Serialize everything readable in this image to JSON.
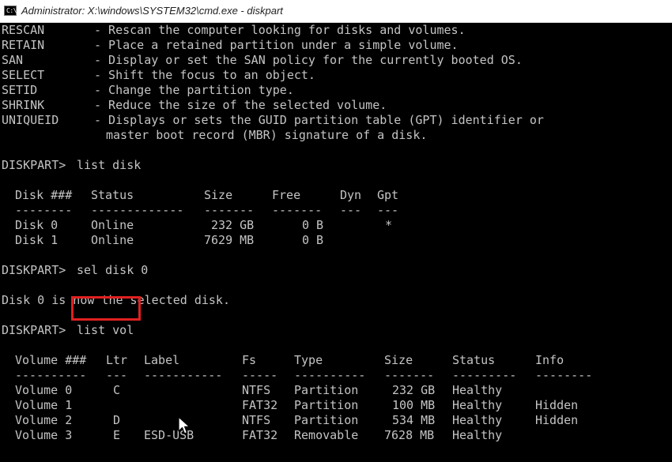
{
  "window": {
    "title": "Administrator: X:\\windows\\SYSTEM32\\cmd.exe - diskpart",
    "icon": "cmd-icon",
    "icon_text": "C:\\."
  },
  "help_commands": [
    {
      "name": "RESCAN",
      "desc": "- Rescan the computer looking for disks and volumes."
    },
    {
      "name": "RETAIN",
      "desc": "- Place a retained partition under a simple volume."
    },
    {
      "name": "SAN",
      "desc": "- Display or set the SAN policy for the currently booted OS."
    },
    {
      "name": "SELECT",
      "desc": "- Shift the focus to an object."
    },
    {
      "name": "SETID",
      "desc": "- Change the partition type."
    },
    {
      "name": "SHRINK",
      "desc": "- Reduce the size of the selected volume."
    },
    {
      "name": "UNIQUEID",
      "desc": "- Displays or sets the GUID partition table (GPT) identifier or"
    }
  ],
  "help_continuation": "master boot record (MBR) signature of a disk.",
  "prompt": "DISKPART>",
  "commands": {
    "list_disk": "list disk",
    "sel_disk": "sel disk 0",
    "list_vol": "list vol"
  },
  "disk_table": {
    "headers": [
      "Disk ###",
      "Status",
      "Size",
      "Free",
      "Dyn",
      "Gpt"
    ],
    "separators": [
      "--------",
      "-------------",
      "-------",
      "-------",
      "---",
      "---"
    ],
    "rows": [
      [
        "Disk 0",
        "Online",
        "232 GB",
        "0 B",
        "",
        "*"
      ],
      [
        "Disk 1",
        "Online",
        "7629 MB",
        "0 B",
        "",
        ""
      ]
    ]
  },
  "selected_message": "Disk 0 is now the selected disk.",
  "volume_table": {
    "headers": [
      "Volume ###",
      "Ltr",
      "Label",
      "Fs",
      "Type",
      "Size",
      "Status",
      "Info"
    ],
    "separators": [
      "----------",
      "---",
      "-----------",
      "-----",
      "----------",
      "-------",
      "---------",
      "--------"
    ],
    "rows": [
      [
        "Volume 0",
        "C",
        "",
        "NTFS",
        "Partition",
        "232 GB",
        "Healthy",
        ""
      ],
      [
        "Volume 1",
        "",
        "",
        "FAT32",
        "Partition",
        "100 MB",
        "Healthy",
        "Hidden"
      ],
      [
        "Volume 2",
        "D",
        "",
        "NTFS",
        "Partition",
        "534 MB",
        "Healthy",
        "Hidden"
      ],
      [
        "Volume 3",
        "E",
        "ESD-USB",
        "FAT32",
        "Removable",
        "7628 MB",
        "Healthy",
        ""
      ]
    ]
  },
  "colors": {
    "console_background": "#000000",
    "console_text": "#c4c4c4",
    "highlight_box": "#e02020"
  },
  "mouse_cursor": "arrow-cursor-icon"
}
